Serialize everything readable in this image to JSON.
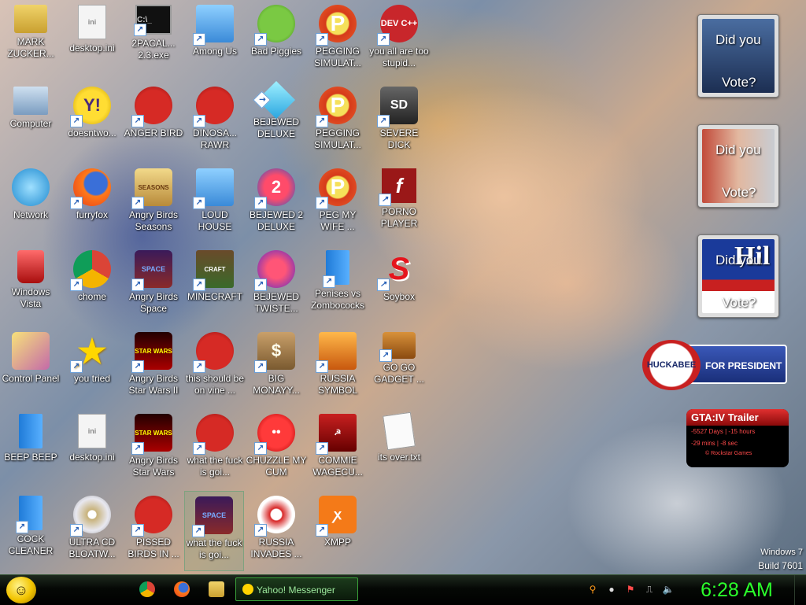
{
  "desktop": {
    "icons": [
      {
        "label": "MARK ZUCKER...",
        "glyph": "folder-icon",
        "sym": ""
      },
      {
        "label": "desktop.ini",
        "glyph": "document-icon",
        "sym": "ini"
      },
      {
        "label": "2PACAL... 2.3.exe",
        "glyph": "console-icon",
        "sym": "C:\\_"
      },
      {
        "label": "Among Us",
        "glyph": "among-us-icon",
        "sym": ""
      },
      {
        "label": "Bad Piggies",
        "glyph": "pig-icon",
        "sym": ""
      },
      {
        "label": "PEGGING SIMULAT...",
        "glyph": "p-icon",
        "sym": "P"
      },
      {
        "label": "you all are too stupid...",
        "glyph": "dev-cpp-icon",
        "sym": "DEV C++"
      },
      {
        "label": "Computer",
        "glyph": "computer-icon",
        "sym": ""
      },
      {
        "label": "doesntwo...",
        "glyph": "yahoo-icon",
        "sym": "Y!"
      },
      {
        "label": "ANGER BIRD",
        "glyph": "angry-bird-icon",
        "sym": ""
      },
      {
        "label": "DINOSA... RAWR",
        "glyph": "angry-bird-icon",
        "sym": ""
      },
      {
        "label": "BEJEWED DELUXE",
        "glyph": "gem-icon",
        "sym": ""
      },
      {
        "label": "PEGGING SIMULAT...",
        "glyph": "p-icon",
        "sym": "P"
      },
      {
        "label": "SEVERE DICK",
        "glyph": "sd-icon",
        "sym": "SD"
      },
      {
        "label": "Network",
        "glyph": "network-icon",
        "sym": ""
      },
      {
        "label": "furryfox",
        "glyph": "firefox-icon",
        "sym": ""
      },
      {
        "label": "Angry Birds Seasons",
        "glyph": "seasons-icon",
        "sym": "SEASONS"
      },
      {
        "label": "LOUD HOUSE",
        "glyph": "house-icon",
        "sym": ""
      },
      {
        "label": "BEJEWED 2 DELUXE",
        "glyph": "gem2-icon",
        "sym": "2"
      },
      {
        "label": "PEG MY WIFE ...",
        "glyph": "p-icon",
        "sym": "P"
      },
      {
        "label": "PORNO PLAYER",
        "glyph": "flash-icon",
        "sym": "f"
      },
      {
        "label": "Windows Vista",
        "glyph": "recycle-bin-icon",
        "sym": ""
      },
      {
        "label": "chome",
        "glyph": "chrome-icon",
        "sym": ""
      },
      {
        "label": "Angry Birds Space",
        "glyph": "space-icon",
        "sym": "SPACE"
      },
      {
        "label": "MINECRAFT",
        "glyph": "minecraft-icon",
        "sym": "CRAFT"
      },
      {
        "label": "BEJEWED TWISTE...",
        "glyph": "twist-icon",
        "sym": ""
      },
      {
        "label": "Penises vs Zombococks",
        "glyph": "book-icon",
        "sym": ""
      },
      {
        "label": "Soybox",
        "glyph": "soybox-icon",
        "sym": "S"
      },
      {
        "label": "Control Panel",
        "glyph": "control-panel-icon",
        "sym": ""
      },
      {
        "label": "you tried",
        "glyph": "star-icon",
        "sym": "★"
      },
      {
        "label": "Angry Birds Star Wars II",
        "glyph": "star-wars-icon",
        "sym": "STAR WARS"
      },
      {
        "label": "this should be on vine ...",
        "glyph": "angry-bird-icon",
        "sym": ""
      },
      {
        "label": "BIG MONAYY...",
        "glyph": "money-bag-icon",
        "sym": "$"
      },
      {
        "label": "RUSSIA SYMBOL",
        "glyph": "russia-icon",
        "sym": ""
      },
      {
        "label": "GO GO GADGET ...",
        "glyph": "briefcase-icon",
        "sym": ""
      },
      {
        "label": "BEEP BEEP",
        "glyph": "book-icon",
        "sym": ""
      },
      {
        "label": "desktop.ini",
        "glyph": "document-icon",
        "sym": "ini"
      },
      {
        "label": "Angry Birds Star Wars",
        "glyph": "star-wars-icon",
        "sym": "STAR WARS"
      },
      {
        "label": "what the fuck is goi...",
        "glyph": "angry-bird-icon",
        "sym": ""
      },
      {
        "label": "CHUZZLE MY CUM",
        "glyph": "chuzzle-icon",
        "sym": "••"
      },
      {
        "label": "COMMIE WAGECU...",
        "glyph": "commie-icon",
        "sym": "☭"
      },
      {
        "label": "its over.txt",
        "glyph": "text-file-icon",
        "sym": ""
      },
      {
        "label": "COCK CLEANER",
        "glyph": "book-icon",
        "sym": ""
      },
      {
        "label": "ULTRA CD BLOATW...",
        "glyph": "disc-icon",
        "sym": ""
      },
      {
        "label": "PISSED BIRDS IN ...",
        "glyph": "angry-bird-icon",
        "sym": ""
      },
      {
        "label": "what the fuck is goi...",
        "glyph": "angry-bird-space-icon",
        "sym": "SPACE"
      },
      {
        "label": "RUSSIA INVADES ...",
        "glyph": "nuclear-icon",
        "sym": ""
      },
      {
        "label": "XMPP",
        "glyph": "xampp-icon",
        "sym": "ꭗ"
      }
    ]
  },
  "gadgets": {
    "vote1": {
      "text_top": "Did you",
      "text_bottom": "Vote?"
    },
    "vote2": {
      "text_top": "Did you",
      "text_bottom": "Vote?"
    },
    "vote3": {
      "text_top": "Did you",
      "text_bottom": "Vote?",
      "overlay": "Hil"
    },
    "huckabee": {
      "badge": "HUCKABEE",
      "text": "FOR PRESIDENT"
    },
    "gta": {
      "title": "GTA:IV  Trailer",
      "line1": "-5527 Days  |  -15 hours",
      "line2": "-29 mins  |  -8 sec",
      "footer": "©  Rockstar Games"
    }
  },
  "watermark": {
    "line1": "Windows 7",
    "line2": "Build 7601"
  },
  "taskbar": {
    "start_symbol": "☺",
    "quick_launch": [
      {
        "name": "chrome-icon"
      },
      {
        "name": "firefox-icon"
      },
      {
        "name": "explorer-icon"
      }
    ],
    "open_windows": [
      {
        "label": "Yahoo! Messenger",
        "icon": "yahoo-icon"
      }
    ],
    "tray": [
      {
        "name": "search-icon",
        "sym": "⚲"
      },
      {
        "name": "messenger-icon",
        "sym": "●"
      },
      {
        "name": "flag-icon",
        "sym": "⚑"
      },
      {
        "name": "network-tray-icon",
        "sym": "⎍"
      },
      {
        "name": "volume-icon",
        "sym": "🔈"
      }
    ],
    "clock": "6:28 AM"
  },
  "colors": {
    "clock": "#2bff2b",
    "taskbar": "#000000",
    "accent": "#3aa23a"
  }
}
